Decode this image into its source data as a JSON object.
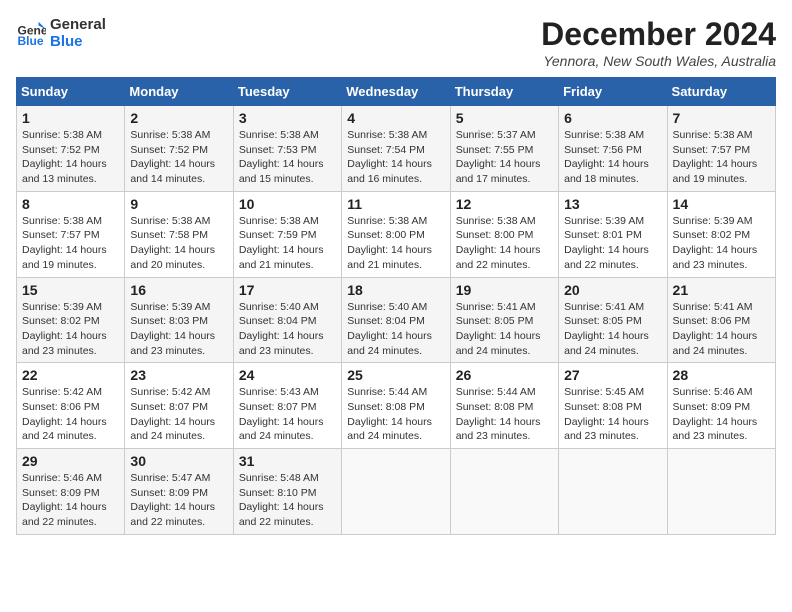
{
  "logo": {
    "general": "General",
    "blue": "Blue"
  },
  "title": {
    "month_year": "December 2024",
    "location": "Yennora, New South Wales, Australia"
  },
  "days_of_week": [
    "Sunday",
    "Monday",
    "Tuesday",
    "Wednesday",
    "Thursday",
    "Friday",
    "Saturday"
  ],
  "weeks": [
    [
      {
        "day": "1",
        "sunrise": "5:38 AM",
        "sunset": "7:52 PM",
        "daylight": "14 hours and 13 minutes."
      },
      {
        "day": "2",
        "sunrise": "5:38 AM",
        "sunset": "7:52 PM",
        "daylight": "14 hours and 14 minutes."
      },
      {
        "day": "3",
        "sunrise": "5:38 AM",
        "sunset": "7:53 PM",
        "daylight": "14 hours and 15 minutes."
      },
      {
        "day": "4",
        "sunrise": "5:38 AM",
        "sunset": "7:54 PM",
        "daylight": "14 hours and 16 minutes."
      },
      {
        "day": "5",
        "sunrise": "5:37 AM",
        "sunset": "7:55 PM",
        "daylight": "14 hours and 17 minutes."
      },
      {
        "day": "6",
        "sunrise": "5:38 AM",
        "sunset": "7:56 PM",
        "daylight": "14 hours and 18 minutes."
      },
      {
        "day": "7",
        "sunrise": "5:38 AM",
        "sunset": "7:57 PM",
        "daylight": "14 hours and 19 minutes."
      }
    ],
    [
      {
        "day": "8",
        "sunrise": "5:38 AM",
        "sunset": "7:57 PM",
        "daylight": "14 hours and 19 minutes."
      },
      {
        "day": "9",
        "sunrise": "5:38 AM",
        "sunset": "7:58 PM",
        "daylight": "14 hours and 20 minutes."
      },
      {
        "day": "10",
        "sunrise": "5:38 AM",
        "sunset": "7:59 PM",
        "daylight": "14 hours and 21 minutes."
      },
      {
        "day": "11",
        "sunrise": "5:38 AM",
        "sunset": "8:00 PM",
        "daylight": "14 hours and 21 minutes."
      },
      {
        "day": "12",
        "sunrise": "5:38 AM",
        "sunset": "8:00 PM",
        "daylight": "14 hours and 22 minutes."
      },
      {
        "day": "13",
        "sunrise": "5:39 AM",
        "sunset": "8:01 PM",
        "daylight": "14 hours and 22 minutes."
      },
      {
        "day": "14",
        "sunrise": "5:39 AM",
        "sunset": "8:02 PM",
        "daylight": "14 hours and 23 minutes."
      }
    ],
    [
      {
        "day": "15",
        "sunrise": "5:39 AM",
        "sunset": "8:02 PM",
        "daylight": "14 hours and 23 minutes."
      },
      {
        "day": "16",
        "sunrise": "5:39 AM",
        "sunset": "8:03 PM",
        "daylight": "14 hours and 23 minutes."
      },
      {
        "day": "17",
        "sunrise": "5:40 AM",
        "sunset": "8:04 PM",
        "daylight": "14 hours and 23 minutes."
      },
      {
        "day": "18",
        "sunrise": "5:40 AM",
        "sunset": "8:04 PM",
        "daylight": "14 hours and 24 minutes."
      },
      {
        "day": "19",
        "sunrise": "5:41 AM",
        "sunset": "8:05 PM",
        "daylight": "14 hours and 24 minutes."
      },
      {
        "day": "20",
        "sunrise": "5:41 AM",
        "sunset": "8:05 PM",
        "daylight": "14 hours and 24 minutes."
      },
      {
        "day": "21",
        "sunrise": "5:41 AM",
        "sunset": "8:06 PM",
        "daylight": "14 hours and 24 minutes."
      }
    ],
    [
      {
        "day": "22",
        "sunrise": "5:42 AM",
        "sunset": "8:06 PM",
        "daylight": "14 hours and 24 minutes."
      },
      {
        "day": "23",
        "sunrise": "5:42 AM",
        "sunset": "8:07 PM",
        "daylight": "14 hours and 24 minutes."
      },
      {
        "day": "24",
        "sunrise": "5:43 AM",
        "sunset": "8:07 PM",
        "daylight": "14 hours and 24 minutes."
      },
      {
        "day": "25",
        "sunrise": "5:44 AM",
        "sunset": "8:08 PM",
        "daylight": "14 hours and 24 minutes."
      },
      {
        "day": "26",
        "sunrise": "5:44 AM",
        "sunset": "8:08 PM",
        "daylight": "14 hours and 23 minutes."
      },
      {
        "day": "27",
        "sunrise": "5:45 AM",
        "sunset": "8:08 PM",
        "daylight": "14 hours and 23 minutes."
      },
      {
        "day": "28",
        "sunrise": "5:46 AM",
        "sunset": "8:09 PM",
        "daylight": "14 hours and 23 minutes."
      }
    ],
    [
      {
        "day": "29",
        "sunrise": "5:46 AM",
        "sunset": "8:09 PM",
        "daylight": "14 hours and 22 minutes."
      },
      {
        "day": "30",
        "sunrise": "5:47 AM",
        "sunset": "8:09 PM",
        "daylight": "14 hours and 22 minutes."
      },
      {
        "day": "31",
        "sunrise": "5:48 AM",
        "sunset": "8:10 PM",
        "daylight": "14 hours and 22 minutes."
      },
      null,
      null,
      null,
      null
    ]
  ],
  "labels": {
    "sunrise": "Sunrise: ",
    "sunset": "Sunset: ",
    "daylight": "Daylight: "
  }
}
